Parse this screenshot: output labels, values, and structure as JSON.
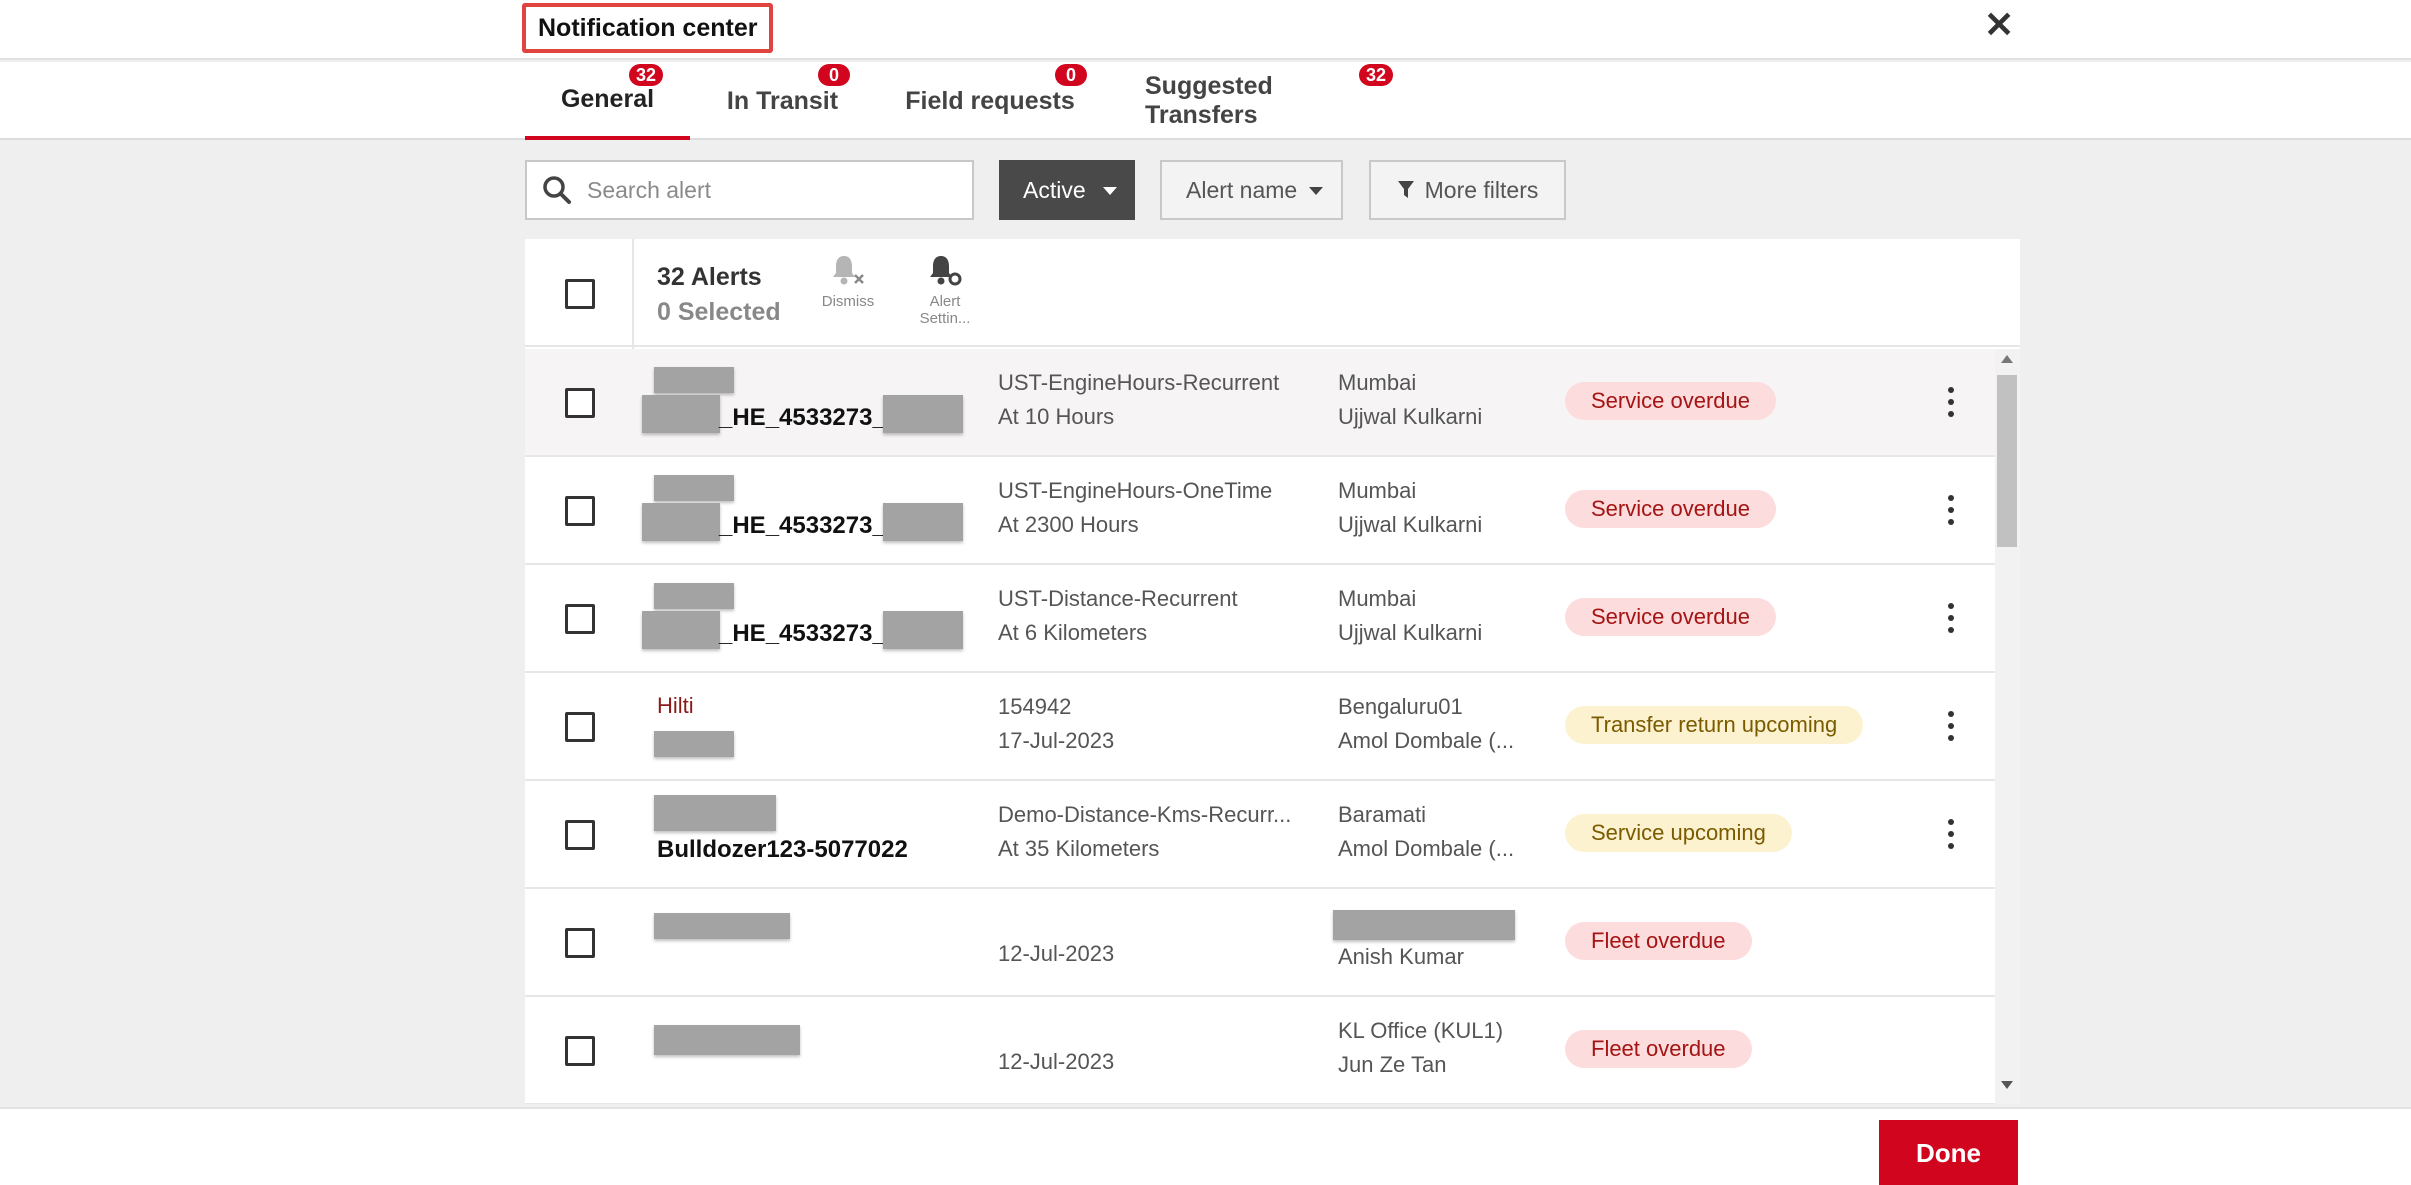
{
  "header": {
    "title": "Notification center",
    "close_icon": "close-icon"
  },
  "tabs": [
    {
      "label": "General",
      "badge": "32",
      "active": true
    },
    {
      "label": "In Transit",
      "badge": "0"
    },
    {
      "label": "Field requests",
      "badge": "0"
    },
    {
      "label": "Suggested Transfers",
      "badge": "32"
    }
  ],
  "filters": {
    "search_placeholder": "Search alert",
    "status": "Active",
    "alert_name": "Alert name",
    "more_filters": "More filters"
  },
  "list_header": {
    "alerts_count": "32 Alerts",
    "selected_count": "0 Selected",
    "dismiss_label": "Dismiss",
    "alert_settings_label_1": "Alert",
    "alert_settings_label_2": "Settin..."
  },
  "rows": [
    {
      "title": "_HE_4533273_",
      "desc_1": "UST-EngineHours-Recurrent",
      "desc_2": "At 10 Hours",
      "loc_1": "Mumbai",
      "loc_2": "Ujjwal Kulkarni",
      "status": "Service overdue",
      "status_color": "#fcdcdc"
    },
    {
      "title": "_HE_4533273_",
      "desc_1": "UST-EngineHours-OneTime",
      "desc_2": "At 2300 Hours",
      "loc_1": "Mumbai",
      "loc_2": "Ujjwal Kulkarni",
      "status": "Service overdue",
      "status_color": "#fcdcdc"
    },
    {
      "title": "_HE_4533273_",
      "desc_1": "UST-Distance-Recurrent",
      "desc_2": "At 6 Kilometers",
      "loc_1": "Mumbai",
      "loc_2": "Ujjwal Kulkarni",
      "status": "Service overdue",
      "status_color": "#fcdcdc"
    },
    {
      "subtitle": "Hilti",
      "desc_1": "154942",
      "desc_2": "17-Jul-2023",
      "loc_1": "Bengaluru01",
      "loc_2": "Amol Dombale (...",
      "status": "Transfer return upcoming",
      "status_color": "#fdf2cf"
    },
    {
      "title": "Bulldozer123-5077022",
      "desc_1": "Demo-Distance-Kms-Recurr...",
      "desc_2": "At 35 Kilometers",
      "loc_1": "Baramati",
      "loc_2": "Amol Dombale (...",
      "status": "Service upcoming",
      "status_color": "#fdf2cf"
    },
    {
      "desc_2": "12-Jul-2023",
      "loc_2": "Anish Kumar",
      "status": "Fleet overdue",
      "status_color": "#fcdcdc"
    },
    {
      "desc_2": "12-Jul-2023",
      "loc_1": "KL Office (KUL1)",
      "loc_2": "Jun Ze Tan",
      "status": "Fleet overdue",
      "status_color": "#fcdcdc"
    }
  ],
  "footer": {
    "done_label": "Done"
  },
  "colors": {
    "accent": "#d2051e",
    "highlight_border": "#e0443e"
  }
}
